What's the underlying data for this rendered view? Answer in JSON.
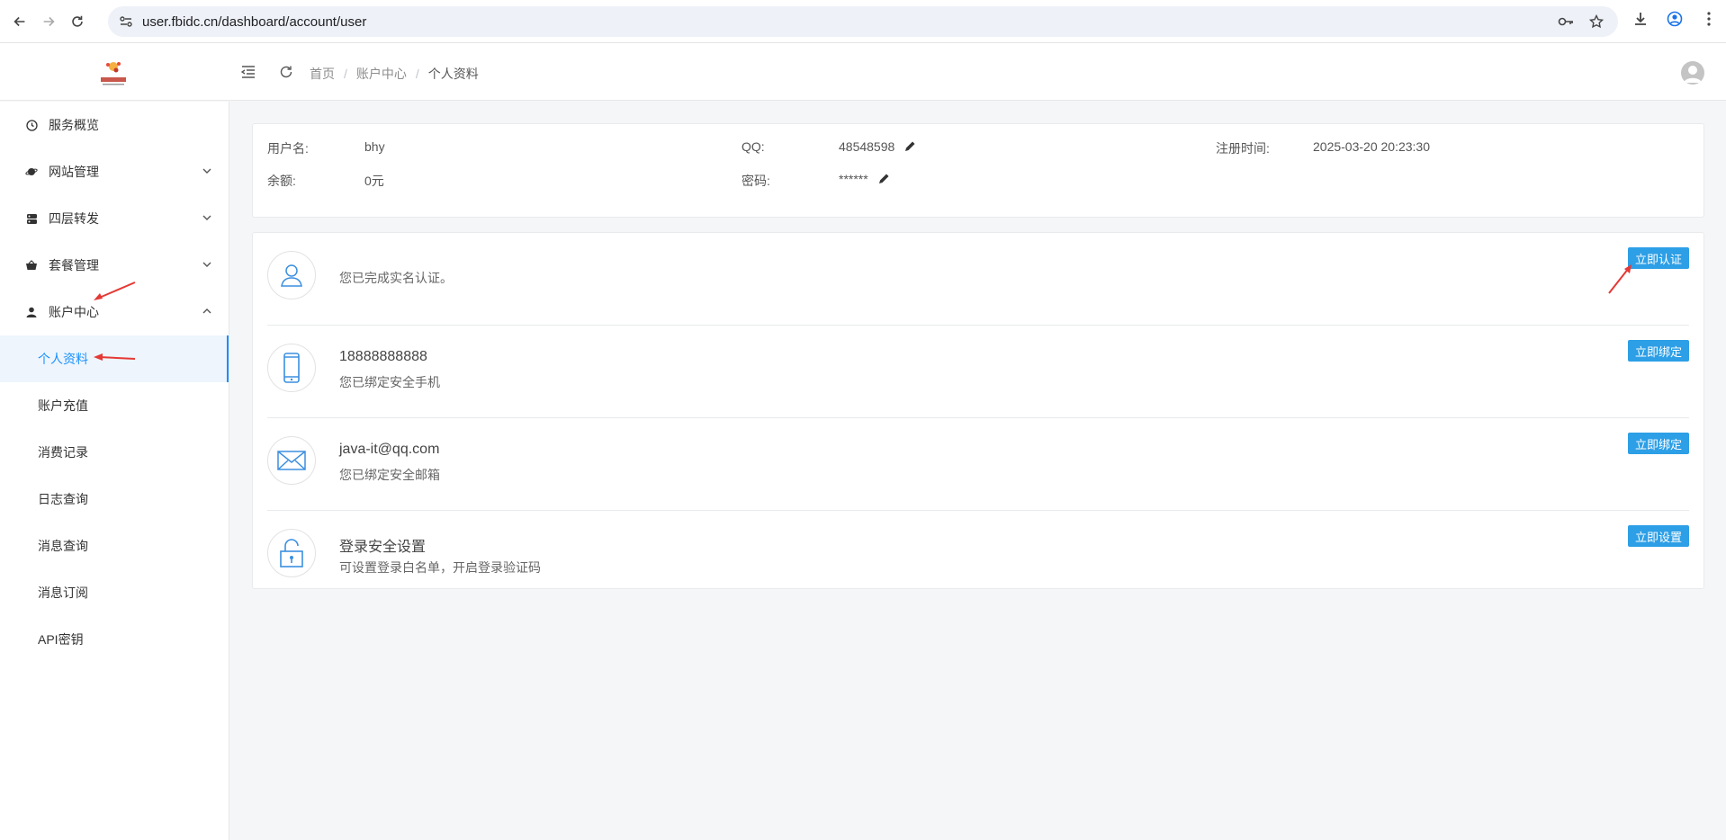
{
  "browser": {
    "url": "user.fbidc.cn/dashboard/account/user"
  },
  "header": {
    "breadcrumb": [
      "首页",
      "账户中心",
      "个人资料"
    ]
  },
  "sidebar": {
    "items": [
      {
        "label": "服务概览",
        "icon": "dashboard-icon"
      },
      {
        "label": "网站管理",
        "icon": "planet-icon",
        "expandable": true
      },
      {
        "label": "四层转发",
        "icon": "server-icon",
        "expandable": true
      },
      {
        "label": "套餐管理",
        "icon": "basket-icon",
        "expandable": true
      },
      {
        "label": "账户中心",
        "icon": "user-icon",
        "expandable": true,
        "expanded": true
      }
    ],
    "sub_items": [
      {
        "label": "个人资料",
        "active": true
      },
      {
        "label": "账户充值"
      },
      {
        "label": "消费记录"
      },
      {
        "label": "日志查询"
      },
      {
        "label": "消息查询"
      },
      {
        "label": "消息订阅"
      },
      {
        "label": "API密钥"
      }
    ]
  },
  "profile": {
    "username_label": "用户名:",
    "username": "bhy",
    "qq_label": "QQ:",
    "qq": "48548598",
    "register_label": "注册时间:",
    "register_time": "2025-03-20 20:23:30",
    "balance_label": "余额:",
    "balance": "0元",
    "password_label": "密码:",
    "password": "******"
  },
  "security": [
    {
      "title": "",
      "desc": "您已完成实名认证。",
      "button": "立即认证",
      "icon": "person-icon"
    },
    {
      "title": "18888888888",
      "desc": "您已绑定安全手机",
      "button": "立即绑定",
      "icon": "phone-icon"
    },
    {
      "title": "java-it@qq.com",
      "desc": "您已绑定安全邮箱",
      "button": "立即绑定",
      "icon": "mail-icon"
    },
    {
      "title": "登录安全设置",
      "desc": "可设置登录白名单，开启登录验证码",
      "button": "立即设置",
      "icon": "lock-icon"
    }
  ],
  "colors": {
    "accent": "#1890ff",
    "button": "#2d9fe6",
    "annotation": "#e53935"
  }
}
